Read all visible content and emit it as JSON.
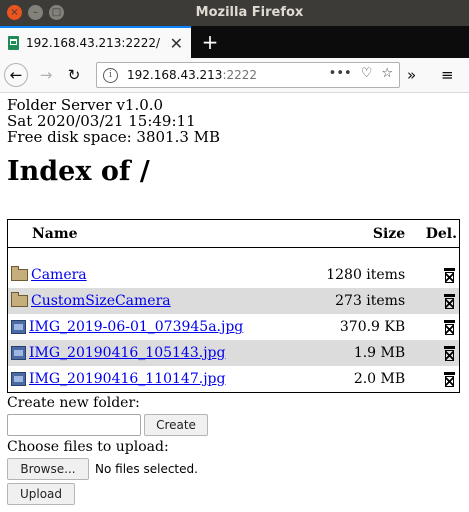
{
  "window": {
    "title": "Mozilla Firefox"
  },
  "tab": {
    "label": "192.168.43.213:2222/"
  },
  "address": {
    "host": "192.168.43.213",
    "port": ":2222"
  },
  "server": {
    "version": "Folder Server v1.0.0",
    "datetime": "Sat 2020/03/21 15:49:11",
    "disk": "Free disk space: 3801.3 MB"
  },
  "heading": "Index of /",
  "table": {
    "headers": {
      "name": "Name",
      "size": "Size",
      "del": "Del."
    },
    "rows": [
      {
        "type": "folder",
        "name": "Camera",
        "size": "1280 items"
      },
      {
        "type": "folder",
        "name": "CustomSizeCamera",
        "size": "273 items"
      },
      {
        "type": "image",
        "name": "IMG_2019-06-01_073945a.jpg",
        "size": "370.9 KB"
      },
      {
        "type": "image",
        "name": "IMG_20190416_105143.jpg",
        "size": "1.9 MB"
      },
      {
        "type": "image",
        "name": "IMG_20190416_110147.jpg",
        "size": "2.0 MB"
      }
    ]
  },
  "forms": {
    "new_folder_label": "Create new folder:",
    "create_label": "Create",
    "upload_label_text": "Choose files to upload:",
    "browse_label": "Browse...",
    "no_files": "No files selected.",
    "upload_label": "Upload"
  }
}
